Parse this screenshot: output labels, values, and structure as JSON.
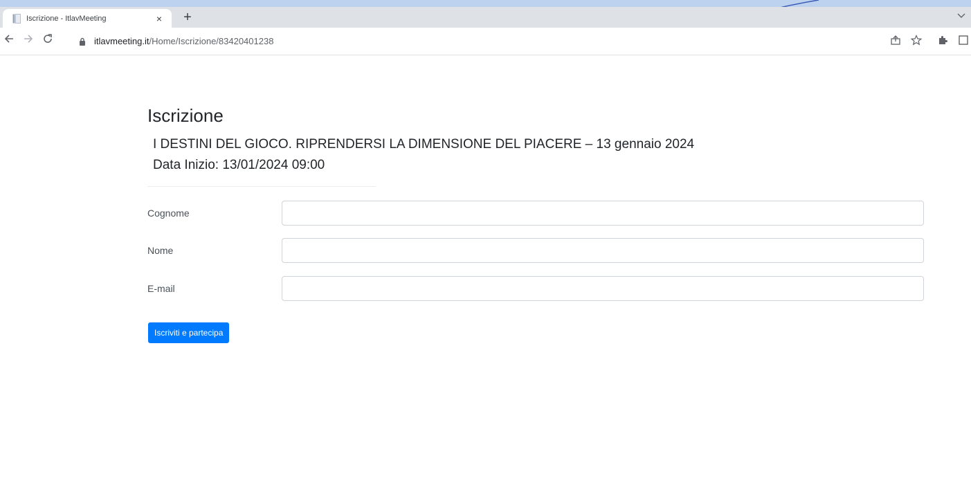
{
  "browser": {
    "tab_title": "Iscrizione - ItlavMeeting",
    "tab_close": "×",
    "new_tab": "+",
    "url_host": "itlavmeeting.it",
    "url_path": "/Home/Iscrizione/83420401238",
    "icons": [
      "back-arrow-icon",
      "forward-arrow-icon",
      "reload-icon",
      "lock-icon",
      "share-icon",
      "star-icon",
      "extensions-icon",
      "sidebar-icon",
      "chevron-down-icon"
    ]
  },
  "page": {
    "title": "Iscrizione",
    "event_title": "I DESTINI DEL GIOCO. RIPRENDERSI LA DIMENSIONE DEL PIACERE – 13 gennaio 2024",
    "event_date": "Data Inizio: 13/01/2024 09:00"
  },
  "form": {
    "cognome_label": "Cognome",
    "cognome_value": "",
    "nome_label": "Nome",
    "nome_value": "",
    "email_label": "E-mail",
    "email_value": "",
    "submit_label": "Iscriviti e partecipa"
  },
  "colors": {
    "accent": "#007bff",
    "desktop": "#bcd2ef",
    "tabstrip": "#dee1e6"
  }
}
